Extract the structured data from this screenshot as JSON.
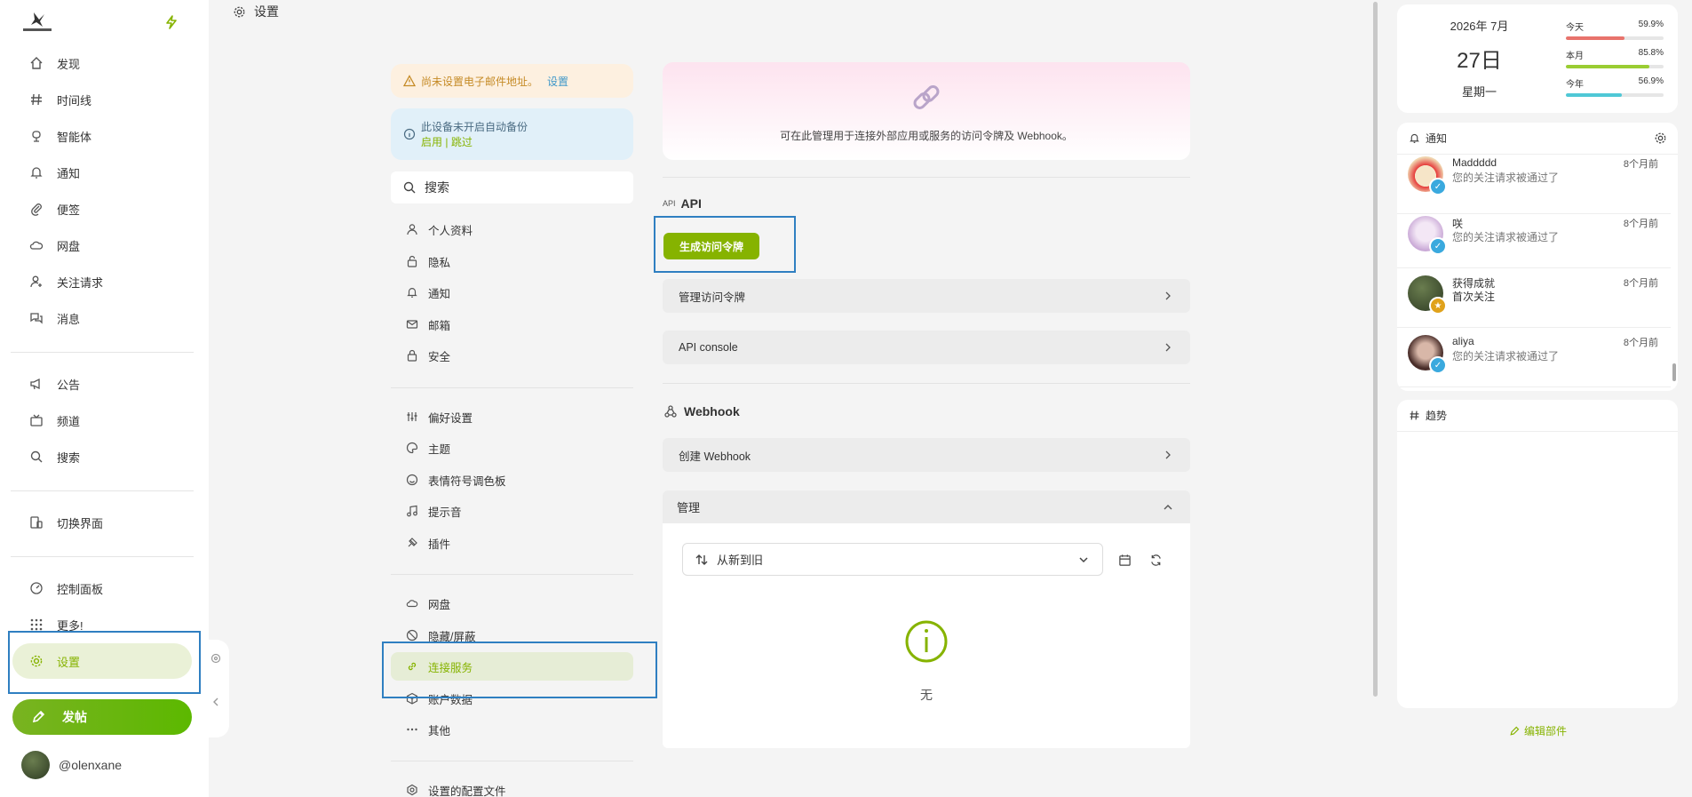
{
  "colors": {
    "accent": "#86b300",
    "highlight": "#2f7fc1",
    "link": "#4098c9"
  },
  "nav": {
    "items": [
      {
        "label": "发现",
        "icon": "home-icon"
      },
      {
        "label": "时间线",
        "icon": "hash-icon"
      },
      {
        "label": "智能体",
        "icon": "robot-icon"
      },
      {
        "label": "通知",
        "icon": "bell-icon"
      },
      {
        "label": "便签",
        "icon": "paperclip-icon"
      },
      {
        "label": "网盘",
        "icon": "cloud-icon"
      },
      {
        "label": "关注请求",
        "icon": "user-plus-icon"
      },
      {
        "label": "消息",
        "icon": "messages-icon"
      },
      {
        "label": "公告",
        "icon": "speaker-icon"
      },
      {
        "label": "频道",
        "icon": "tv-icon"
      },
      {
        "label": "搜索",
        "icon": "search-icon"
      },
      {
        "label": "切换界面",
        "icon": "switch-ui-icon"
      },
      {
        "label": "控制面板",
        "icon": "dashboard-icon"
      },
      {
        "label": "更多!",
        "icon": "grid-icon"
      },
      {
        "label": "设置",
        "icon": "gear-icon"
      }
    ],
    "post_label": "发帖",
    "account": "@olenxane"
  },
  "header": {
    "title": "设置"
  },
  "settings_menu": {
    "email_warning": "尚未设置电子邮件地址。",
    "email_link": "设置",
    "backup_text": "此设备未开启自动备份",
    "backup_enable": "启用",
    "backup_sep": " | ",
    "backup_skip": "跳过",
    "search_placeholder": "搜索",
    "items": [
      {
        "label": "个人资料",
        "icon": "user-icon"
      },
      {
        "label": "隐私",
        "icon": "lock-open-icon"
      },
      {
        "label": "通知",
        "icon": "bell-icon"
      },
      {
        "label": "邮箱",
        "icon": "mail-icon"
      },
      {
        "label": "安全",
        "icon": "lock-icon"
      },
      {
        "label": "偏好设置",
        "icon": "sliders-icon"
      },
      {
        "label": "主题",
        "icon": "palette-icon"
      },
      {
        "label": "表情符号调色板",
        "icon": "mood-icon"
      },
      {
        "label": "提示音",
        "icon": "music-icon"
      },
      {
        "label": "插件",
        "icon": "plug-icon"
      },
      {
        "label": "网盘",
        "icon": "cloud-icon"
      },
      {
        "label": "隐藏/屏蔽",
        "icon": "ban-icon"
      },
      {
        "label": "连接服务",
        "icon": "link-icon"
      },
      {
        "label": "账户数据",
        "icon": "package-icon"
      },
      {
        "label": "其他",
        "icon": "dots-icon"
      },
      {
        "label": "设置的配置文件",
        "icon": "settings-profile-icon"
      }
    ]
  },
  "content": {
    "hero_text": "可在此管理用于连接外部应用或服务的访问令牌及 Webhook。",
    "api_prefix": "API",
    "api_title": "API",
    "generate_token": "生成访问令牌",
    "manage_tokens": "管理访问令牌",
    "api_console": "API console",
    "webhook_title": "Webhook",
    "create_webhook": "创建 Webhook",
    "manage_title": "管理",
    "sort_value": "从新到旧",
    "empty_text": "无"
  },
  "calendar": {
    "year_month": "2026年 7月",
    "day": "27日",
    "weekday": "星期一",
    "progress": [
      {
        "label": "今天",
        "value": "59.9%",
        "ratio": 0.599,
        "color": "#e8736c"
      },
      {
        "label": "本月",
        "value": "85.8%",
        "ratio": 0.858,
        "color": "#9acd32"
      },
      {
        "label": "今年",
        "value": "56.9%",
        "ratio": 0.569,
        "color": "#4fc8d6"
      }
    ]
  },
  "notifications": {
    "title": "通知",
    "items": [
      {
        "name": "Maddddd",
        "text": "您的关注请求被通过了",
        "time": "8个月前"
      },
      {
        "name": "咲",
        "text": "您的关注请求被通过了",
        "time": "8个月前"
      },
      {
        "name": "获得成就",
        "text": "首次关注",
        "time": "8个月前"
      },
      {
        "name": "aliya",
        "text": "您的关注请求被通过了",
        "time": "8个月前"
      }
    ]
  },
  "trends": {
    "title": "趋势"
  },
  "edit_widgets": "编辑部件"
}
